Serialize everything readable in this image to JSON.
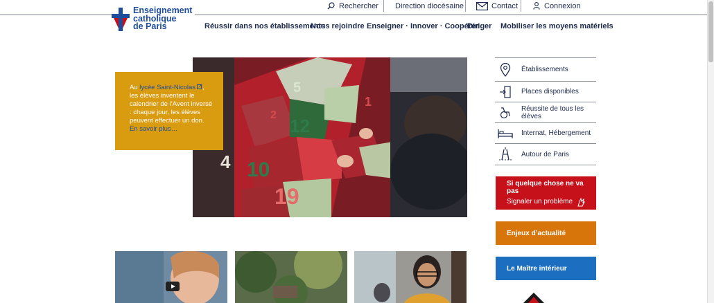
{
  "brand": {
    "line1": "Enseignement",
    "line2": "catholique",
    "line3": "de Paris",
    "color": "#1e4d9b"
  },
  "topbar": {
    "search": "Rechercher",
    "direction": "Direction diocésaine",
    "contact": "Contact",
    "login": "Connexion"
  },
  "nav": {
    "items": [
      "Réussir dans nos établissements",
      "Nous rejoindre",
      "Enseigner · Innover · Coopérer",
      "Diriger",
      "Mobiliser les moyens matériels"
    ]
  },
  "hero": {
    "caption_prefix": "Au ",
    "caption_link": "lycée Saint-Nicolas",
    "caption_body": ", les élèves inventent le calendrier de l’Avent inversé : chaque jour, les élèves peuvent effectuer un don.",
    "caption_more": "En savoir plus…"
  },
  "sidebar": {
    "items": [
      {
        "label": "Établissements",
        "icon": "map-pin-icon"
      },
      {
        "label": "Places disponibles",
        "icon": "door-enter-icon"
      },
      {
        "label": "Réussite de tous les élèves",
        "icon": "wheelchair-icon"
      },
      {
        "label": "Internat, Hébergement",
        "icon": "bed-icon"
      },
      {
        "label": "Autour de Paris",
        "icon": "eiffel-tower-icon"
      }
    ],
    "alert_title": "Si quelque chose ne va pas",
    "alert_sub": "Signaler un problème",
    "news": "Enjeux d’actualité",
    "teacher": "Le Maître intérieur"
  },
  "colors": {
    "red": "#c7111a",
    "orange": "#d7750b",
    "blue": "#1c6ec0",
    "caption_bg": "#d99b0f"
  }
}
